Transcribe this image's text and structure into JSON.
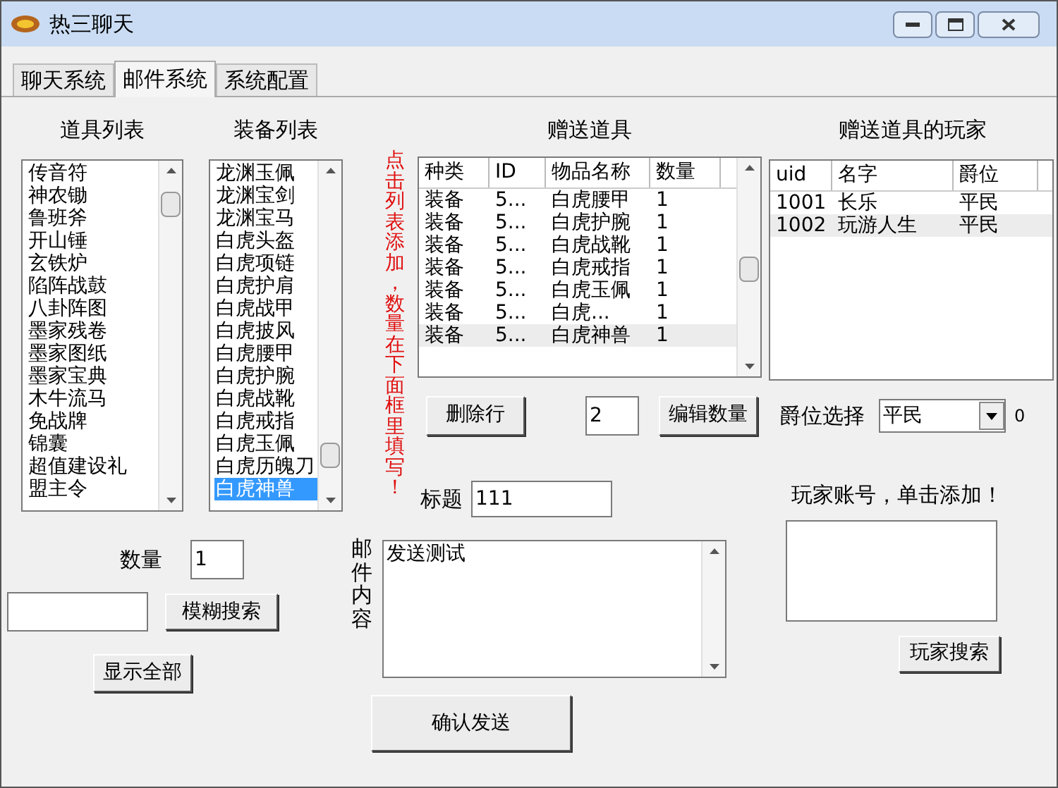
{
  "window": {
    "title": "热三聊天"
  },
  "tabs": [
    {
      "label": "聊天系统",
      "selected": false
    },
    {
      "label": "邮件系统",
      "selected": true
    },
    {
      "label": "系统配置",
      "selected": false
    }
  ],
  "item_list": {
    "title": "道具列表",
    "items": [
      {
        "label": "传音符",
        "selected": false
      },
      {
        "label": "神农锄",
        "selected": false
      },
      {
        "label": "鲁班斧",
        "selected": false
      },
      {
        "label": "开山锤",
        "selected": false
      },
      {
        "label": "玄铁炉",
        "selected": false
      },
      {
        "label": "陷阵战鼓",
        "selected": false
      },
      {
        "label": "八卦阵图",
        "selected": false
      },
      {
        "label": "墨家残卷",
        "selected": false
      },
      {
        "label": "墨家图纸",
        "selected": false
      },
      {
        "label": "墨家宝典",
        "selected": false
      },
      {
        "label": "木牛流马",
        "selected": false
      },
      {
        "label": "免战牌",
        "selected": false
      },
      {
        "label": "锦囊",
        "selected": false
      },
      {
        "label": "超值建设礼",
        "selected": false
      },
      {
        "label": "盟主令",
        "selected": false
      }
    ]
  },
  "equipment_list": {
    "title": "装备列表",
    "items": [
      {
        "label": "龙渊玉佩",
        "selected": false
      },
      {
        "label": "龙渊宝剑",
        "selected": false
      },
      {
        "label": "龙渊宝马",
        "selected": false
      },
      {
        "label": "白虎头盔",
        "selected": false
      },
      {
        "label": "白虎项链",
        "selected": false
      },
      {
        "label": "白虎护肩",
        "selected": false
      },
      {
        "label": "白虎战甲",
        "selected": false
      },
      {
        "label": "白虎披风",
        "selected": false
      },
      {
        "label": "白虎腰甲",
        "selected": false
      },
      {
        "label": "白虎护腕",
        "selected": false
      },
      {
        "label": "白虎战靴",
        "selected": false
      },
      {
        "label": "白虎戒指",
        "selected": false
      },
      {
        "label": "白虎玉佩",
        "selected": false
      },
      {
        "label": "白虎历魄刀",
        "selected": false
      },
      {
        "label": "白虎神兽",
        "selected": true
      }
    ]
  },
  "hint": "点击列表添加，数量在下面框里填写！",
  "gift_items": {
    "title": "赠送道具",
    "columns": [
      "种类",
      "ID",
      "物品名称",
      "数量"
    ],
    "rows": [
      {
        "cells": [
          "装备",
          "5...",
          "白虎腰甲",
          "1"
        ],
        "selected": false
      },
      {
        "cells": [
          "装备",
          "5...",
          "白虎护腕",
          "1"
        ],
        "selected": false
      },
      {
        "cells": [
          "装备",
          "5...",
          "白虎战靴",
          "1"
        ],
        "selected": false
      },
      {
        "cells": [
          "装备",
          "5...",
          "白虎戒指",
          "1"
        ],
        "selected": false
      },
      {
        "cells": [
          "装备",
          "5...",
          "白虎玉佩",
          "1"
        ],
        "selected": false
      },
      {
        "cells": [
          "装备",
          "5...",
          "白虎...",
          "1"
        ],
        "selected": false
      },
      {
        "cells": [
          "装备",
          "5...",
          "白虎神兽",
          "1"
        ],
        "selected": true
      }
    ]
  },
  "gift_players": {
    "title": "赠送道具的玩家",
    "columns": [
      "uid",
      "名字",
      "爵位"
    ],
    "rows": [
      {
        "cells": [
          "1001",
          "长乐",
          "平民"
        ],
        "selected": false
      },
      {
        "cells": [
          "1002",
          "玩游人生",
          "平民"
        ],
        "selected": true
      }
    ]
  },
  "delete_row_button": "删除行",
  "edit_quantity_value": "2",
  "edit_quantity_button": "编辑数量",
  "rank_label": "爵位选择",
  "rank_value": "平民",
  "rank_extra": "0",
  "subject_label": "标题",
  "subject_value": "111",
  "account_label": "玩家账号，单击添加！",
  "player_search_button": "玩家搜索",
  "quantity_label": "数量",
  "quantity_value": "1",
  "fuzzy_search_button": "模糊搜索",
  "show_all_button": "显示全部",
  "content_label": "邮件内容",
  "content_value": "发送测试",
  "send_button": "确认发送"
}
